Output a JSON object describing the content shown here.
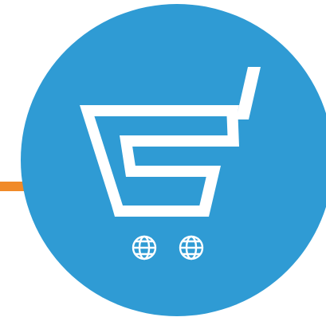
{
  "logo": {
    "icon": "shopping-cart-globe-wheels-icon",
    "colors": {
      "circle": "#2f9bd4",
      "accent_line": "#f08a28",
      "cart": "#ffffff",
      "background": "#ffffff"
    }
  }
}
